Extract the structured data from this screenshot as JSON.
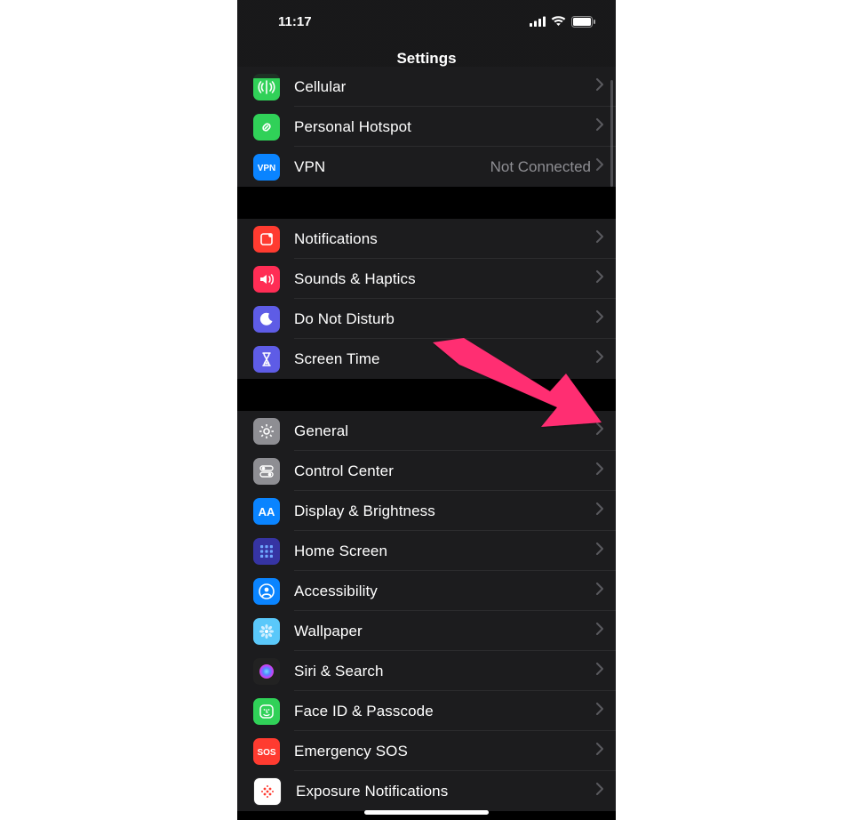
{
  "status": {
    "time": "11:17"
  },
  "header": {
    "title": "Settings"
  },
  "groups": [
    {
      "rows": [
        {
          "key": "cellular",
          "label": "Cellular",
          "icon": "antenna",
          "color": "#30d158"
        },
        {
          "key": "hotspot",
          "label": "Personal Hotspot",
          "icon": "link",
          "color": "#30d158"
        },
        {
          "key": "vpn",
          "label": "VPN",
          "icon": "vpn",
          "color": "#0a84ff",
          "value": "Not Connected"
        }
      ]
    },
    {
      "rows": [
        {
          "key": "notifications",
          "label": "Notifications",
          "icon": "bell",
          "color": "#ff3b30"
        },
        {
          "key": "sounds",
          "label": "Sounds & Haptics",
          "icon": "speaker",
          "color": "#ff2d55"
        },
        {
          "key": "dnd",
          "label": "Do Not Disturb",
          "icon": "moon",
          "color": "#5e5ce6"
        },
        {
          "key": "screentime",
          "label": "Screen Time",
          "icon": "hourglass",
          "color": "#5e5ce6"
        }
      ]
    },
    {
      "rows": [
        {
          "key": "general",
          "label": "General",
          "icon": "gear",
          "color": "#8e8e93"
        },
        {
          "key": "controlcenter",
          "label": "Control Center",
          "icon": "switches",
          "color": "#8e8e93"
        },
        {
          "key": "display",
          "label": "Display & Brightness",
          "icon": "aa",
          "color": "#0a84ff"
        },
        {
          "key": "homescreen",
          "label": "Home Screen",
          "icon": "grid",
          "color": "#3634a3"
        },
        {
          "key": "accessibility",
          "label": "Accessibility",
          "icon": "person",
          "color": "#0a84ff"
        },
        {
          "key": "wallpaper",
          "label": "Wallpaper",
          "icon": "flower",
          "color": "#5ac8fa"
        },
        {
          "key": "siri",
          "label": "Siri & Search",
          "icon": "siri",
          "color": "#222222"
        },
        {
          "key": "faceid",
          "label": "Face ID & Passcode",
          "icon": "face",
          "color": "#30d158"
        },
        {
          "key": "sos",
          "label": "Emergency SOS",
          "icon": "sos",
          "color": "#ff3b30"
        },
        {
          "key": "exposure",
          "label": "Exposure Notifications",
          "icon": "exposure",
          "color": "#ffffff"
        }
      ]
    }
  ],
  "annotation": {
    "arrow_target": "general",
    "arrow_color": "#ff2d72"
  }
}
